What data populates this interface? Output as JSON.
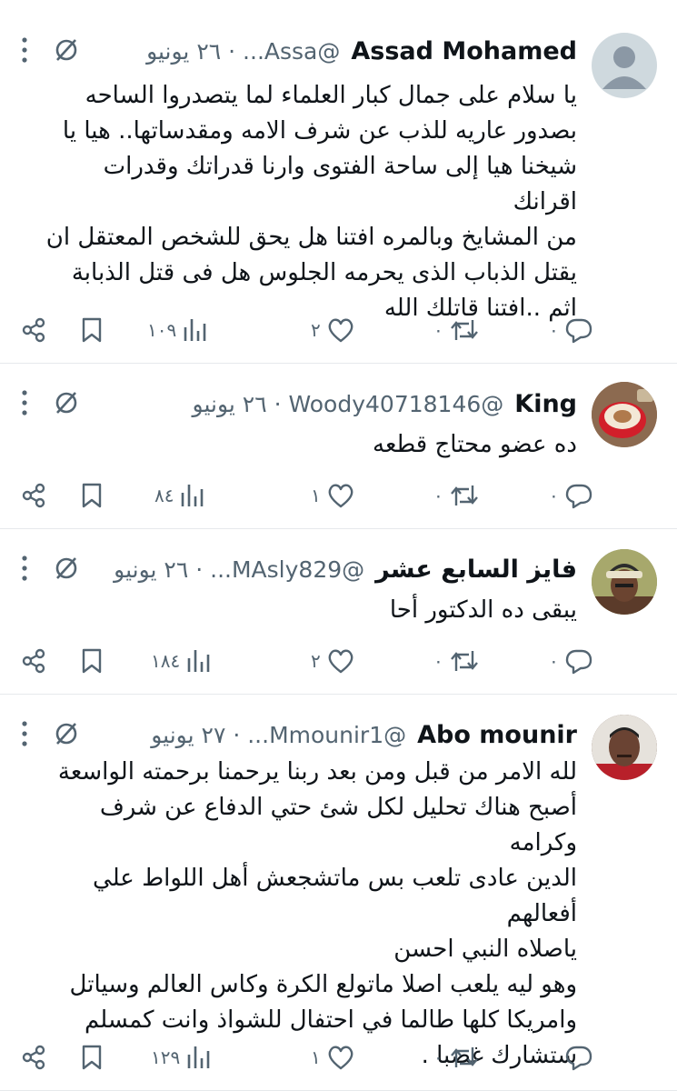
{
  "tweets": [
    {
      "name": "Assad Mohamed",
      "handle": "@Assa...",
      "sep": "·",
      "date": "٢٦ يونيو",
      "text": "يا سلام على جمال كبار العلماء لما يتصدروا الساحه\nبصدور عاريه للذب عن شرف الامه ومقدساتها.. هيا يا\nشيخنا هيا إلى ساحة الفتوى وارنا قدراتك وقدرات اقرانك\nمن المشايخ وبالمره افتنا هل يحق للشخص المعتقل ان\nيقتل الذباب الذى يحرمه الجلوس هل فى قتل الذبابة\nاثم ..افتنا قاتلك الله",
      "replies": "٠",
      "retweets": "٠",
      "likes": "٢",
      "views": "١٠٩",
      "avatar": "default"
    },
    {
      "name": "King",
      "handle": "@Woody40718146",
      "sep": "·",
      "date": "٢٦ يونيو",
      "text": "ده عضو محتاج قطعه",
      "replies": "٠",
      "retweets": "٠",
      "likes": "١",
      "views": "٨٤",
      "avatar": "coffee"
    },
    {
      "name": "فايز السابع عشر",
      "handle": "@MAsly829...",
      "sep": "·",
      "date": "٢٦ يونيو",
      "text": "يبقى ده الدكتور أحا",
      "replies": "٠",
      "retweets": "٠",
      "likes": "٢",
      "views": "١٨٤",
      "avatar": "man-cap"
    },
    {
      "name": "Abo mounir",
      "handle": "@Mmounir1...",
      "sep": "·",
      "date": "٢٧ يونيو",
      "text": "لله الامر من قبل ومن بعد ربنا يرحمنا برحمته الواسعة\nأصبح هناك تحليل لكل شئ حتي الدفاع عن شرف وكرامه\nالدين عادى تلعب بس ماتشجعش أهل اللواط علي أفعالهم\nياصلاه النبي احسن\nوهو ليه يلعب اصلا ماتولع الكرة وكاس العالم وسياتل\nوامريكا كلها طالما في احتفال للشواذ وانت كمسلم\nستشارك غصبا .",
      "replies": "٠",
      "retweets": "٠",
      "likes": "١",
      "views": "١٢٩",
      "avatar": "man-portrait"
    }
  ],
  "colors": {
    "text": "#0f1419",
    "secondary": "#536471",
    "divider": "#e6e9ec"
  },
  "icons": [
    "more-icon",
    "grok-icon",
    "reply-icon",
    "retweet-icon",
    "like-icon",
    "views-icon",
    "bookmark-icon",
    "share-icon"
  ]
}
